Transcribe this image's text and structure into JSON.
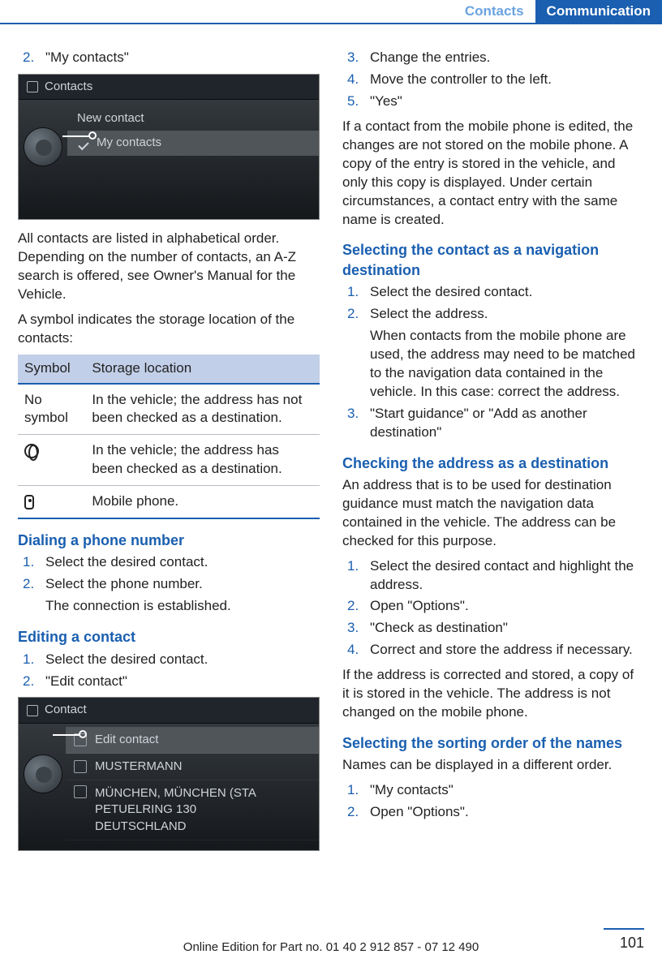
{
  "header": {
    "chapter": "Contacts",
    "section": "Communication"
  },
  "left": {
    "step2_num": "2.",
    "step2_text": "\"My contacts\"",
    "screenshot1": {
      "title": "Contacts",
      "item1": "New contact",
      "item2": "My contacts"
    },
    "para1": "All contacts are listed in alphabetical order. Depending on the number of contacts, an A-Z search is offered, see Owner's Manual for the Vehicle.",
    "para2": "A symbol indicates the storage location of the contacts:",
    "table": {
      "h1": "Symbol",
      "h2": "Storage location",
      "r1c1": "No symbol",
      "r1c2": "In the vehicle; the address has not been checked as a destination.",
      "r2c2": "In the vehicle; the address has been checked as a destination.",
      "r3c2": "Mobile phone."
    },
    "sec_dial": {
      "title": "Dialing a phone number",
      "s1n": "1.",
      "s1t": "Select the desired contact.",
      "s2n": "2.",
      "s2t": "Select the phone number.",
      "s2sub": "The connection is established."
    },
    "sec_edit": {
      "title": "Editing a contact",
      "s1n": "1.",
      "s1t": "Select the desired contact.",
      "s2n": "2.",
      "s2t": "\"Edit contact\""
    },
    "screenshot2": {
      "title": "Contact",
      "r1": "Edit contact",
      "r2": "MUSTERMANN",
      "r3a": "MÜNCHEN, MÜNCHEN (STA",
      "r3b": "PETUELRING 130",
      "r3c": "DEUTSCHLAND"
    }
  },
  "right": {
    "steps_top": {
      "s3n": "3.",
      "s3t": "Change the entries.",
      "s4n": "4.",
      "s4t": "Move the controller to the left.",
      "s5n": "5.",
      "s5t": "\"Yes\""
    },
    "para_edit_note": "If a contact from the mobile phone is edited, the changes are not stored on the mobile phone. A copy of the entry is stored in the vehicle, and only this copy is displayed. Under certain circumstances, a contact entry with the same name is created.",
    "sec_navdest": {
      "title": "Selecting the contact as a navigation destination",
      "s1n": "1.",
      "s1t": "Select the desired contact.",
      "s2n": "2.",
      "s2t": "Select the address.",
      "s2sub": "When contacts from the mobile phone are used, the address may need to be matched to the navigation data contained in the vehicle. In this case: correct the address.",
      "s3n": "3.",
      "s3t": "\"Start guidance\" or \"Add as another destination\""
    },
    "sec_check": {
      "title": "Checking the address as a destination",
      "intro": "An address that is to be used for destination guidance must match the navigation data contained in the vehicle. The address can be checked for this purpose.",
      "s1n": "1.",
      "s1t": "Select the desired contact and highlight the address.",
      "s2n": "2.",
      "s2t": "Open \"Options\".",
      "s3n": "3.",
      "s3t": "\"Check as destination\"",
      "s4n": "4.",
      "s4t": "Correct and store the address if necessary.",
      "outro": "If the address is corrected and stored, a copy of it is stored in the vehicle. The address is not changed on the mobile phone."
    },
    "sec_sort": {
      "title": "Selecting the sorting order of the names",
      "intro": "Names can be displayed in a different order.",
      "s1n": "1.",
      "s1t": "\"My contacts\"",
      "s2n": "2.",
      "s2t": "Open \"Options\"."
    }
  },
  "footer": {
    "text": "Online Edition for Part no. 01 40 2 912 857 - 07 12 490",
    "page": "101"
  }
}
